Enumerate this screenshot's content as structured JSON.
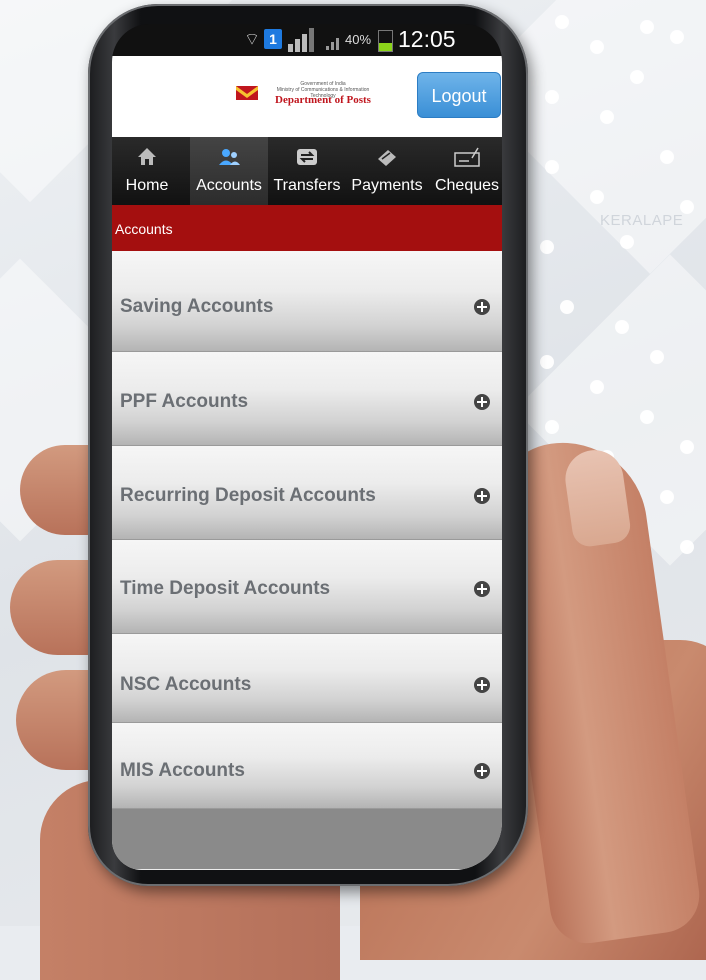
{
  "background": {
    "watermark": "KERALAPE"
  },
  "status_bar": {
    "wifi_icon": "wifi-icon",
    "notification_badge": "1",
    "battery_percent": "40%",
    "time": "12:05"
  },
  "header": {
    "logo_small_text": "Government of India\nMinistry of Communications & Information Technology",
    "logo_name": "Department of Posts",
    "logout_label": "Logout"
  },
  "nav": {
    "items": [
      {
        "label": "Home",
        "icon": "home-icon"
      },
      {
        "label": "Accounts",
        "icon": "users-icon",
        "active": true
      },
      {
        "label": "Transfers",
        "icon": "transfer-icon"
      },
      {
        "label": "Payments",
        "icon": "payment-icon"
      },
      {
        "label": "Cheques",
        "icon": "cheque-icon"
      }
    ]
  },
  "breadcrumb": {
    "current": "Accounts"
  },
  "accounts": {
    "items": [
      {
        "label": "Saving Accounts"
      },
      {
        "label": "PPF Accounts"
      },
      {
        "label": "Recurring Deposit Accounts"
      },
      {
        "label": "Time Deposit Accounts"
      },
      {
        "label": "NSC Accounts"
      },
      {
        "label": "MIS  Accounts"
      }
    ]
  },
  "colors": {
    "breadcrumb_bg": "#a40f0f",
    "logout_bg": "#3a8fd6",
    "brand_red": "#c0161e",
    "nav_bg": "#111111"
  }
}
